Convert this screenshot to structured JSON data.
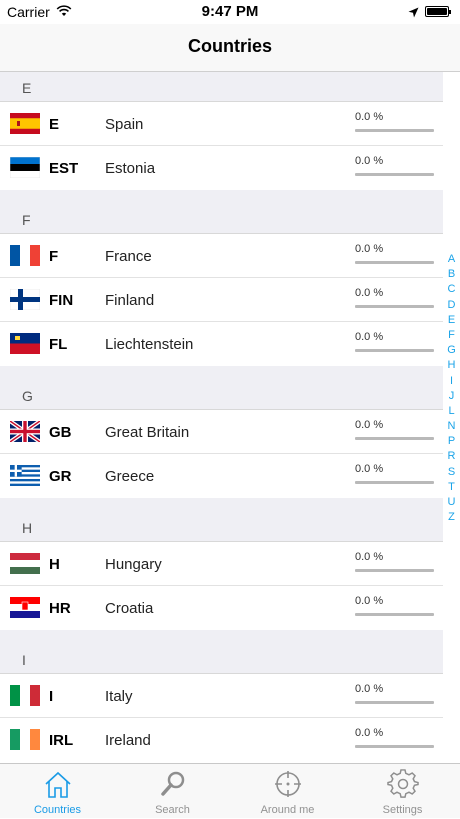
{
  "status": {
    "carrier": "Carrier",
    "time": "9:47 PM"
  },
  "nav": {
    "title": "Countries"
  },
  "sections": [
    {
      "letter": "E",
      "rows": [
        {
          "flag": "spain-flag",
          "code": "E",
          "name": "Spain",
          "percent": "0.0 %",
          "progress": 0
        },
        {
          "flag": "estonia-flag",
          "code": "EST",
          "name": "Estonia",
          "percent": "0.0 %",
          "progress": 0
        }
      ]
    },
    {
      "letter": "F",
      "rows": [
        {
          "flag": "france-flag",
          "code": "F",
          "name": "France",
          "percent": "0.0 %",
          "progress": 0
        },
        {
          "flag": "finland-flag",
          "code": "FIN",
          "name": "Finland",
          "percent": "0.0 %",
          "progress": 0
        },
        {
          "flag": "liechtenstein-flag",
          "code": "FL",
          "name": "Liechtenstein",
          "percent": "0.0 %",
          "progress": 0
        }
      ]
    },
    {
      "letter": "G",
      "rows": [
        {
          "flag": "great-britain-flag",
          "code": "GB",
          "name": "Great Britain",
          "percent": "0.0 %",
          "progress": 0
        },
        {
          "flag": "greece-flag",
          "code": "GR",
          "name": "Greece",
          "percent": "0.0 %",
          "progress": 0
        }
      ]
    },
    {
      "letter": "H",
      "rows": [
        {
          "flag": "hungary-flag",
          "code": "H",
          "name": "Hungary",
          "percent": "0.0 %",
          "progress": 0
        },
        {
          "flag": "croatia-flag",
          "code": "HR",
          "name": "Croatia",
          "percent": "0.0 %",
          "progress": 0
        }
      ]
    },
    {
      "letter": "I",
      "rows": [
        {
          "flag": "italy-flag",
          "code": "I",
          "name": "Italy",
          "percent": "0.0 %",
          "progress": 0
        },
        {
          "flag": "ireland-flag",
          "code": "IRL",
          "name": "Ireland",
          "percent": "0.0 %",
          "progress": 0
        }
      ]
    }
  ],
  "index": [
    "A",
    "B",
    "C",
    "D",
    "E",
    "F",
    "G",
    "H",
    "I",
    "J",
    "L",
    "N",
    "P",
    "R",
    "S",
    "T",
    "U",
    "Z"
  ],
  "tabs": [
    {
      "label": "Countries",
      "icon": "house-icon",
      "active": true
    },
    {
      "label": "Search",
      "icon": "magnifier-icon",
      "active": false
    },
    {
      "label": "Around me",
      "icon": "crosshair-icon",
      "active": false
    },
    {
      "label": "Settings",
      "icon": "gear-icon",
      "active": false
    }
  ],
  "colors": {
    "accent": "#1a9be6",
    "index": "#1aa3e8",
    "section_bg": "#efeff4"
  }
}
